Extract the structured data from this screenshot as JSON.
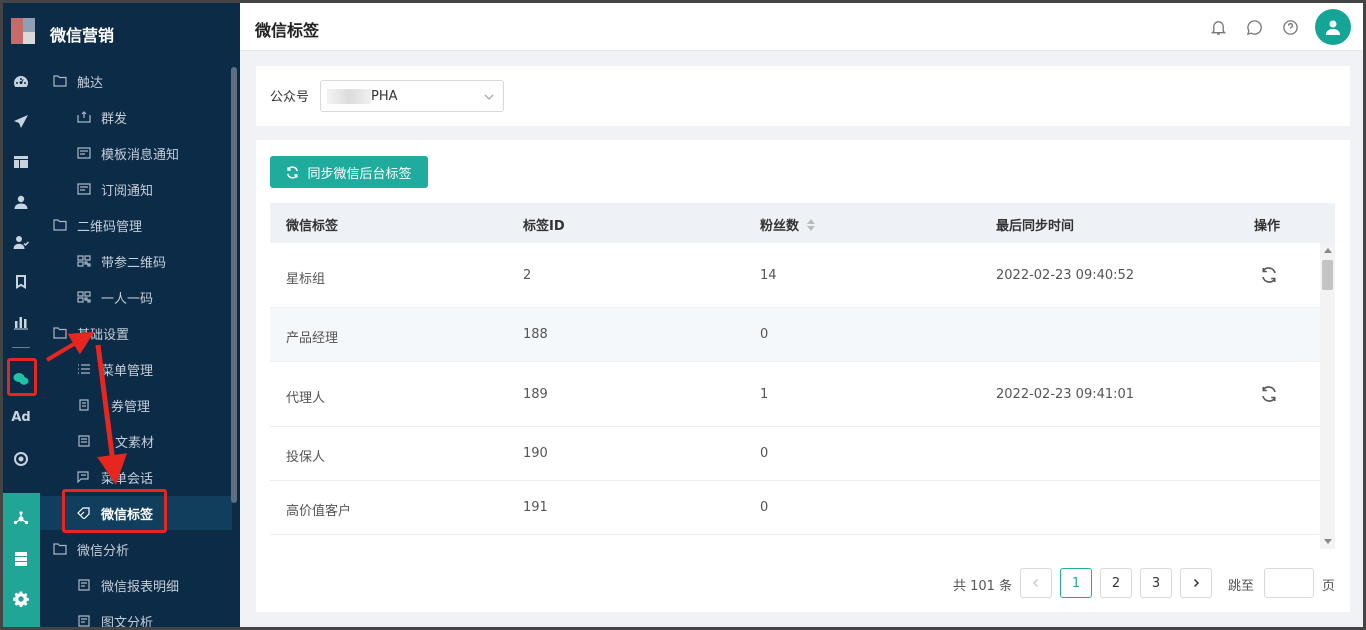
{
  "app": {
    "title": "微信营销"
  },
  "header": {
    "page_title": "微信标签"
  },
  "rail": {
    "items": [
      "dashboard-icon",
      "send-icon",
      "layout-icon",
      "user-icon",
      "users-icon",
      "bookmark-icon",
      "bar-chart-icon",
      "wechat-icon",
      "ad-icon",
      "target-icon",
      "hub-icon",
      "server-icon",
      "gear-icon"
    ],
    "ad_label": "Ad"
  },
  "sidebar": {
    "items": [
      {
        "label": "触达",
        "type": "group"
      },
      {
        "label": "群发",
        "type": "sub"
      },
      {
        "label": "模板消息通知",
        "type": "sub"
      },
      {
        "label": "订阅通知",
        "type": "sub"
      },
      {
        "label": "二维码管理",
        "type": "group"
      },
      {
        "label": "带参二维码",
        "type": "sub"
      },
      {
        "label": "一人一码",
        "type": "sub"
      },
      {
        "label": "基础设置",
        "type": "group"
      },
      {
        "label": "菜单管理",
        "type": "sub"
      },
      {
        "label": "卡券管理",
        "type": "sub"
      },
      {
        "label": "图文素材",
        "type": "sub"
      },
      {
        "label": "菜单会话",
        "type": "sub"
      },
      {
        "label": "微信标签",
        "type": "sub",
        "active": true
      },
      {
        "label": "微信分析",
        "type": "group"
      },
      {
        "label": "微信报表明细",
        "type": "sub"
      },
      {
        "label": "图文分析",
        "type": "sub"
      }
    ]
  },
  "sidebar_display": {
    "item_8": "菜单管理",
    "item_9": "券管理",
    "item_10": "文素材"
  },
  "filter": {
    "label": "公众号",
    "value": "PHA"
  },
  "toolbar": {
    "sync_label": "同步微信后台标签"
  },
  "table": {
    "columns": [
      "微信标签",
      "标签ID",
      "粉丝数",
      "最后同步时间",
      "操作"
    ],
    "rows": [
      {
        "tag": "星标组",
        "id": "2",
        "fans": "14",
        "synced": "2022-02-23 09:40:52",
        "has_action": true
      },
      {
        "tag": "产品经理",
        "id": "188",
        "fans": "0",
        "synced": "",
        "has_action": false
      },
      {
        "tag": "代理人",
        "id": "189",
        "fans": "1",
        "synced": "2022-02-23 09:41:01",
        "has_action": true
      },
      {
        "tag": "投保人",
        "id": "190",
        "fans": "0",
        "synced": "",
        "has_action": false
      },
      {
        "tag": "高价值客户",
        "id": "191",
        "fans": "0",
        "synced": "",
        "has_action": false
      }
    ]
  },
  "pagination": {
    "total_text": "共 101 条",
    "pages": [
      "1",
      "2",
      "3"
    ],
    "current": "1",
    "jump_label": "跳至",
    "page_suffix": "页"
  },
  "colors": {
    "accent": "#1fac9d",
    "sidebar_bg": "#0c2b47",
    "annotation": "#e6261f"
  }
}
